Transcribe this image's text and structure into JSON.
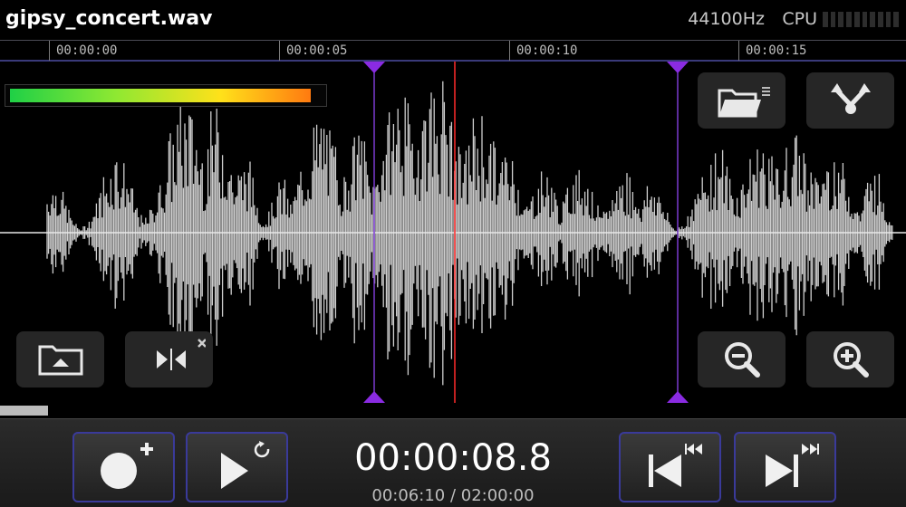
{
  "file": {
    "title": "gipsy_concert.wav",
    "sample_rate": "44100Hz",
    "cpu_label": "CPU"
  },
  "timeline": {
    "ticks": [
      "00:00:00",
      "00:00:05",
      "00:00:10",
      "00:00:15"
    ]
  },
  "input_level": {
    "fraction": 0.96
  },
  "tools": {
    "open_file": "folder-menu-icon",
    "share": "share-icon",
    "import": "folder-upload-icon",
    "split": "split-icon",
    "zoom_out": "zoom-out-icon",
    "zoom_in": "zoom-in-icon"
  },
  "playback": {
    "current_time": "00:00:08.8",
    "position_total": "00:06:10 / 02:00:00"
  },
  "colors": {
    "selection_marker": "#8a2be2",
    "playhead": "#ff2a2a",
    "button_border": "#3a3a9a"
  }
}
